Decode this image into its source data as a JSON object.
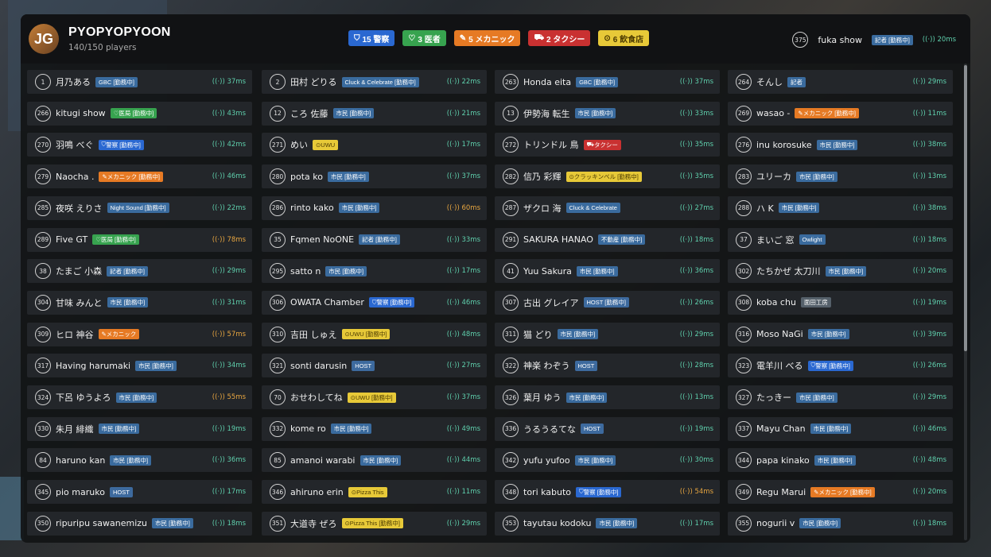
{
  "server": {
    "logo": "JG",
    "name": "PYOPYOPYOON",
    "players": "140/150 players"
  },
  "jobs": [
    {
      "icon": "shield-icon",
      "label": "15 警察",
      "color": "#2a68d1"
    },
    {
      "icon": "medical-icon",
      "label": "3 医者",
      "color": "#37a34f"
    },
    {
      "icon": "wrench-icon",
      "label": "5 メカニック",
      "color": "#e67a24"
    },
    {
      "icon": "car-icon",
      "label": "2 タクシー",
      "color": "#c93131"
    },
    {
      "icon": "food-icon",
      "label": "6 飲食店",
      "color": "#e7c938"
    }
  ],
  "self": {
    "id": "375",
    "name": "fuka show",
    "tag": "記者 [勤務中]",
    "ping": "20ms"
  },
  "rows": [
    [
      {
        "id": "1",
        "name": "月乃ある",
        "tag": "GBC [勤務中]",
        "tagType": "city",
        "ping": "37ms"
      },
      {
        "id": "2",
        "name": "田村 どりる",
        "tag": "Cluck & Celebrate [勤務中]",
        "tagType": "city",
        "ping": "22ms"
      },
      {
        "id": "263",
        "name": "Honda eita",
        "tag": "GBC [勤務中]",
        "tagType": "city",
        "ping": "37ms"
      },
      {
        "id": "264",
        "name": "そんし",
        "tag": "記者",
        "tagType": "news",
        "ping": "29ms"
      }
    ],
    [
      {
        "id": "266",
        "name": "kitugi show",
        "tag": "医局 [勤務中]",
        "tagType": "med",
        "icon": "medical-icon",
        "ping": "43ms"
      },
      {
        "id": "12",
        "name": "ころ 佐藤",
        "tag": "市民 [勤務中]",
        "tagType": "city",
        "ping": "21ms"
      },
      {
        "id": "13",
        "name": "伊勢海 転生",
        "tag": "市民 [勤務中]",
        "tagType": "city",
        "ping": "33ms"
      },
      {
        "id": "269",
        "name": "wasao -",
        "tag": "メカニック [勤務中]",
        "tagType": "mech",
        "icon": "wrench-icon",
        "ping": "11ms"
      }
    ],
    [
      {
        "id": "270",
        "name": "羽鳴 べぐ",
        "tag": "警察 [勤務中]",
        "tagType": "police",
        "icon": "shield-icon",
        "ping": "42ms"
      },
      {
        "id": "271",
        "name": "めい",
        "tag": "UWU",
        "tagType": "food",
        "icon": "food-icon",
        "ping": "17ms"
      },
      {
        "id": "272",
        "name": "トリンドル 鳥",
        "tag": "タクシー",
        "tagType": "taxi",
        "icon": "car-icon",
        "ping": "35ms"
      },
      {
        "id": "276",
        "name": "inu korosuke",
        "tag": "市民 [勤務中]",
        "tagType": "city",
        "ping": "38ms"
      }
    ],
    [
      {
        "id": "279",
        "name": "Naocha .",
        "tag": "メカニック [勤務中]",
        "tagType": "mech",
        "icon": "wrench-icon",
        "ping": "46ms"
      },
      {
        "id": "280",
        "name": "pota ko",
        "tag": "市民 [勤務中]",
        "tagType": "city",
        "ping": "37ms"
      },
      {
        "id": "282",
        "name": "信乃 彩輝",
        "tag": "クラッキンベル [勤務中]",
        "tagType": "food",
        "icon": "food-icon",
        "ping": "35ms"
      },
      {
        "id": "283",
        "name": "ユリーカ",
        "tag": "市民 [勤務中]",
        "tagType": "city",
        "ping": "13ms"
      }
    ],
    [
      {
        "id": "285",
        "name": "夜咲 えりさ",
        "tag": "Night Sound [勤務中]",
        "tagType": "city",
        "ping": "22ms"
      },
      {
        "id": "286",
        "name": "rinto kako",
        "tag": "市民 [勤務中]",
        "tagType": "city",
        "ping": "60ms",
        "warn": true
      },
      {
        "id": "287",
        "name": "ザクロ 海",
        "tag": "Cluck & Celebrate",
        "tagType": "city",
        "ping": "27ms"
      },
      {
        "id": "288",
        "name": "ハ K",
        "tag": "市民 [勤務中]",
        "tagType": "city",
        "ping": "38ms"
      }
    ],
    [
      {
        "id": "289",
        "name": "Five GT",
        "tag": "医局 [勤務中]",
        "tagType": "med",
        "icon": "medical-icon",
        "ping": "78ms",
        "warn": true
      },
      {
        "id": "35",
        "name": "Fqmen NoONE",
        "tag": "記者 [勤務中]",
        "tagType": "news",
        "ping": "33ms"
      },
      {
        "id": "291",
        "name": "SAKURA HANAO",
        "tag": "不動産 [勤務中]",
        "tagType": "city",
        "ping": "18ms"
      },
      {
        "id": "37",
        "name": "まいご 窓",
        "tag": "Owlight",
        "tagType": "city",
        "ping": "18ms"
      }
    ],
    [
      {
        "id": "38",
        "name": "たまご 小森",
        "tag": "記者 [勤務中]",
        "tagType": "news",
        "ping": "29ms"
      },
      {
        "id": "295",
        "name": "satto n",
        "tag": "市民 [勤務中]",
        "tagType": "city",
        "ping": "17ms"
      },
      {
        "id": "41",
        "name": "Yuu Sakura",
        "tag": "市民 [勤務中]",
        "tagType": "city",
        "ping": "36ms"
      },
      {
        "id": "302",
        "name": "たちかぜ 太刀川",
        "tag": "市民 [勤務中]",
        "tagType": "city",
        "ping": "20ms"
      }
    ],
    [
      {
        "id": "304",
        "name": "甘味 みんと",
        "tag": "市民 [勤務中]",
        "tagType": "city",
        "ping": "31ms"
      },
      {
        "id": "306",
        "name": "OWATA Chamber",
        "tag": "警察 [勤務中]",
        "tagType": "police",
        "icon": "shield-icon",
        "ping": "46ms"
      },
      {
        "id": "307",
        "name": "古出 グレイア",
        "tag": "HOST [勤務中]",
        "tagType": "host",
        "ping": "26ms"
      },
      {
        "id": "308",
        "name": "koba chu",
        "tag": "面田工房",
        "tagType": "grey",
        "ping": "19ms"
      }
    ],
    [
      {
        "id": "309",
        "name": "ヒロ 神谷",
        "tag": "メカニック",
        "tagType": "mech",
        "icon": "wrench-icon",
        "ping": "57ms",
        "warn": true
      },
      {
        "id": "310",
        "name": "吉田 しゅえ",
        "tag": "UWU [勤務中]",
        "tagType": "food",
        "icon": "food-icon",
        "ping": "48ms"
      },
      {
        "id": "311",
        "name": "猫 どり",
        "tag": "市民 [勤務中]",
        "tagType": "city",
        "ping": "29ms"
      },
      {
        "id": "316",
        "name": "Moso NaGi",
        "tag": "市民 [勤務中]",
        "tagType": "city",
        "ping": "39ms"
      }
    ],
    [
      {
        "id": "317",
        "name": "Having harumaki",
        "tag": "市民 [勤務中]",
        "tagType": "city",
        "ping": "34ms"
      },
      {
        "id": "321",
        "name": "sonti darusin",
        "tag": "HOST",
        "tagType": "host",
        "ping": "27ms"
      },
      {
        "id": "322",
        "name": "神楽 わぞう",
        "tag": "HOST",
        "tagType": "host",
        "ping": "28ms"
      },
      {
        "id": "323",
        "name": "電羊川 べる",
        "tag": "警察 [勤務中]",
        "tagType": "police",
        "icon": "shield-icon",
        "ping": "26ms"
      }
    ],
    [
      {
        "id": "324",
        "name": "下呂 ゆうよろ",
        "tag": "市民 [勤務中]",
        "tagType": "city",
        "ping": "55ms",
        "warn": true
      },
      {
        "id": "70",
        "name": "おせわしてね",
        "tag": "UWU [勤務中]",
        "tagType": "food",
        "icon": "food-icon",
        "ping": "37ms"
      },
      {
        "id": "326",
        "name": "葉月 ゆう",
        "tag": "市民 [勤務中]",
        "tagType": "city",
        "ping": "13ms"
      },
      {
        "id": "327",
        "name": "たっきー",
        "tag": "市民 [勤務中]",
        "tagType": "city",
        "ping": "29ms"
      }
    ],
    [
      {
        "id": "330",
        "name": "朱月 緋織",
        "tag": "市民 [勤務中]",
        "tagType": "city",
        "ping": "19ms"
      },
      {
        "id": "332",
        "name": "kome ro",
        "tag": "市民 [勤務中]",
        "tagType": "city",
        "ping": "49ms"
      },
      {
        "id": "336",
        "name": "うるうるてな",
        "tag": "HOST",
        "tagType": "host",
        "ping": "19ms"
      },
      {
        "id": "337",
        "name": "Mayu Chan",
        "tag": "市民 [勤務中]",
        "tagType": "city",
        "ping": "46ms"
      }
    ],
    [
      {
        "id": "84",
        "name": "haruno kan",
        "tag": "市民 [勤務中]",
        "tagType": "city",
        "ping": "36ms"
      },
      {
        "id": "85",
        "name": "amanoi warabi",
        "tag": "市民 [勤務中]",
        "tagType": "city",
        "ping": "44ms"
      },
      {
        "id": "342",
        "name": "yufu yufoo",
        "tag": "市民 [勤務中]",
        "tagType": "city",
        "ping": "30ms"
      },
      {
        "id": "344",
        "name": "papa kinako",
        "tag": "市民 [勤務中]",
        "tagType": "city",
        "ping": "48ms"
      }
    ],
    [
      {
        "id": "345",
        "name": "pio maruko",
        "tag": "HOST",
        "tagType": "host",
        "ping": "17ms"
      },
      {
        "id": "346",
        "name": "ahiruno erin",
        "tag": "Pizza This",
        "tagType": "food",
        "icon": "food-icon",
        "ping": "11ms"
      },
      {
        "id": "348",
        "name": "tori kabuto",
        "tag": "警察 [勤務中]",
        "tagType": "police",
        "icon": "shield-icon",
        "ping": "54ms",
        "warn": true
      },
      {
        "id": "349",
        "name": "Regu Marui",
        "tag": "メカニック [勤務中]",
        "tagType": "mech",
        "icon": "wrench-icon",
        "ping": "20ms"
      }
    ],
    [
      {
        "id": "350",
        "name": "ripuripu sawanemizu",
        "tag": "市民 [勤務中]",
        "tagType": "city",
        "ping": "18ms"
      },
      {
        "id": "351",
        "name": "大道寺 ぜろ",
        "tag": "Pizza This [勤務中]",
        "tagType": "food",
        "icon": "food-icon",
        "ping": "29ms"
      },
      {
        "id": "353",
        "name": "tayutau kodoku",
        "tag": "市民 [勤務中]",
        "tagType": "city",
        "ping": "17ms"
      },
      {
        "id": "355",
        "name": "nogurii v",
        "tag": "市民 [勤務中]",
        "tagType": "city",
        "ping": "18ms"
      }
    ]
  ]
}
